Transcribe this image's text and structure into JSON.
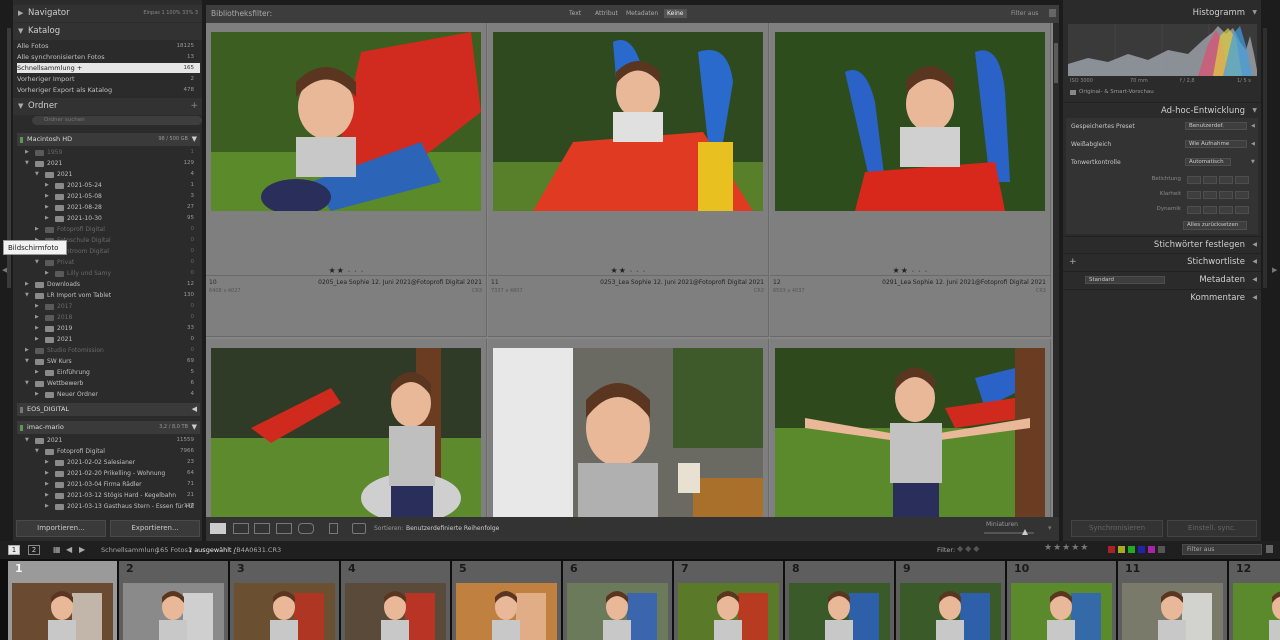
{
  "navigator": {
    "title": "Navigator",
    "zoom_options": "Einpas  1   100%   33%   3"
  },
  "catalog": {
    "title": "Katalog",
    "items": [
      {
        "label": "Alle Fotos",
        "count": "18125"
      },
      {
        "label": "Alle synchronisierten Fotos",
        "count": "13"
      },
      {
        "label": "Schnellsammlung +",
        "count": "165"
      },
      {
        "label": "Vorheriger Import",
        "count": "2"
      },
      {
        "label": "Vorheriger Export als Katalog",
        "count": "478"
      }
    ]
  },
  "folders": {
    "title": "Ordner",
    "search_placeholder": "Ordner suchen",
    "volumes": [
      {
        "label": "Macintosh HD",
        "count": "98 / 500 GB"
      },
      {
        "label": "EOS_DIGITAL",
        "count": ""
      },
      {
        "label": "imac-mario",
        "count": "3,2 / 8,0 TB"
      }
    ],
    "items_hd": [
      {
        "label": "1959",
        "count": "1"
      },
      {
        "label": "2021",
        "count": "129"
      },
      {
        "label": "2021",
        "count": "4"
      },
      {
        "label": "2021-05-24",
        "count": "1"
      },
      {
        "label": "2021-05-08",
        "count": "3"
      },
      {
        "label": "2021-08-28",
        "count": "27"
      },
      {
        "label": "2021-10-30",
        "count": "95"
      },
      {
        "label": "Fotoprofi Digital",
        "count": "0"
      },
      {
        "label": "Fotoschule Digital",
        "count": "0"
      },
      {
        "label": "Lightroom Digital",
        "count": "0"
      },
      {
        "label": "Privat",
        "count": "0"
      },
      {
        "label": "Lilly und Samy",
        "count": "0"
      },
      {
        "label": "Downloads",
        "count": "12"
      },
      {
        "label": "LR Import vom Tablet",
        "count": "130"
      },
      {
        "label": "2017",
        "count": "0"
      },
      {
        "label": "2018",
        "count": "0"
      },
      {
        "label": "2019",
        "count": "33"
      },
      {
        "label": "2021",
        "count": "0"
      },
      {
        "label": "Studio Fotomission",
        "count": "0"
      },
      {
        "label": "SW Kurs",
        "count": "69"
      },
      {
        "label": "Einführung",
        "count": "5"
      },
      {
        "label": "Wettbewerb",
        "count": "6"
      },
      {
        "label": "Neuer Ordner",
        "count": "4"
      }
    ],
    "items_mario": [
      {
        "label": "2021",
        "count": "11559"
      },
      {
        "label": "Fotoprofi Digital",
        "count": "7966"
      },
      {
        "label": "2021-02-02 Salesianer",
        "count": "23"
      },
      {
        "label": "2021-02-20 Prikelling - Wohnung",
        "count": "64"
      },
      {
        "label": "2021-03-04 Firma Rädler",
        "count": "71"
      },
      {
        "label": "2021-03-12 Stögis Hard - Kegelbahn",
        "count": "21"
      },
      {
        "label": "2021-03-13 Gasthaus Stern - Essen für HZ",
        "count": "136"
      }
    ]
  },
  "left_buttons": {
    "import": "Importieren...",
    "export": "Exportieren..."
  },
  "tooltip": "Bildschirmfoto",
  "filterbar": {
    "label": "Bibliotheksfilter:",
    "options": [
      "Text",
      "Attribut",
      "Metadaten",
      "Keine"
    ],
    "active": "Keine",
    "filter_state": "Filter aus"
  },
  "grid": {
    "cells": [
      {
        "index": "10",
        "filename": "0205_Lea Sophie 12. Juni 2021@Fotoprofi Digital 2021",
        "dims": "6408 x 4027",
        "ext": "CR3",
        "rating": 2
      },
      {
        "index": "11",
        "filename": "0253_Lea Sophie 12. Juni 2021@Fotoprofi Digital 2021",
        "dims": "7337 x 4807",
        "ext": "CR3",
        "rating": 2
      },
      {
        "index": "12",
        "filename": "0291_Lea Sophie 12. Juni 2021@Fotoprofi Digital 2021",
        "dims": "6503 x 4037",
        "ext": "CR3",
        "rating": 2
      }
    ]
  },
  "toolbar": {
    "sort_label": "Sortieren:",
    "sort_value": "Benutzerdefinierte Reihenfolge",
    "thumb_label": "Miniaturen"
  },
  "histogram": {
    "title": "Histogramm",
    "iso": "ISO 3000",
    "focal": "70 mm",
    "aperture": "f / 2,8",
    "shutter": "1/ 5 s",
    "preview": "Original- & Smart-Vorschau"
  },
  "quick_develop": {
    "title": "Ad-hoc-Entwicklung",
    "preset_label": "Gespeichertes Preset",
    "preset_value": "Benutzerdef.",
    "wb_label": "Weißabgleich",
    "wb_value": "Wie Aufnahme",
    "tone_label": "Tonwertkontrolle",
    "auto_label": "Automatisch",
    "sliders": [
      "Belichtung",
      "Klarheit",
      "Dynamik"
    ],
    "reset": "Alles zurücksetzen"
  },
  "right_sections": {
    "keywording": "Stichwörter festlegen",
    "keyword_list": "Stichwortliste",
    "metadata": "Metadaten",
    "metadata_preset": "Standard",
    "comments": "Kommentare"
  },
  "right_buttons": {
    "sync_meta": "Synchronisieren",
    "sync_settings": "Einstell. sync."
  },
  "filmstrip": {
    "breadcrumb": "Schnellsammlung",
    "count_text": "165 Fotos /",
    "selected_text": "1 ausgewählt /",
    "filename": "_B4A0631.CR3",
    "filter_label": "Filter:",
    "filter_value": "Filter aus",
    "cells": [
      "1",
      "2",
      "3",
      "4",
      "5",
      "6",
      "7",
      "8",
      "9",
      "10",
      "11",
      "12"
    ]
  },
  "icons": {
    "left_arrow": "triangle-left-icon",
    "right_arrow": "triangle-right-icon"
  }
}
